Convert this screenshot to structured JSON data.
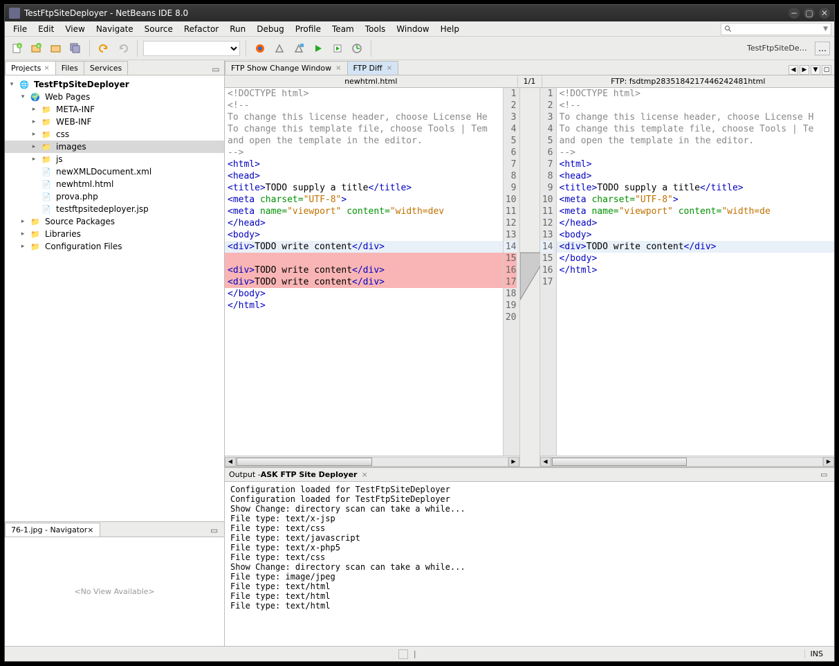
{
  "window_title": "TestFtpSiteDeployer - NetBeans IDE 8.0",
  "menubar": [
    "File",
    "Edit",
    "View",
    "Navigate",
    "Source",
    "Refactor",
    "Run",
    "Debug",
    "Profile",
    "Team",
    "Tools",
    "Window",
    "Help"
  ],
  "toolbar_project_label": "TestFtpSiteDepl...",
  "left_tabs": {
    "projects": "Projects",
    "files": "Files",
    "services": "Services"
  },
  "tree": {
    "root": "TestFtpSiteDeployer",
    "folders": [
      {
        "label": "Web Pages",
        "depth": 1,
        "icon": "web",
        "expanded": true
      },
      {
        "label": "META-INF",
        "depth": 2,
        "icon": "folder"
      },
      {
        "label": "WEB-INF",
        "depth": 2,
        "icon": "folder"
      },
      {
        "label": "css",
        "depth": 2,
        "icon": "folder"
      },
      {
        "label": "images",
        "depth": 2,
        "icon": "folder",
        "selected": true
      },
      {
        "label": "js",
        "depth": 2,
        "icon": "folder"
      },
      {
        "label": "newXMLDocument.xml",
        "depth": 2,
        "icon": "file",
        "leaf": true
      },
      {
        "label": "newhtml.html",
        "depth": 2,
        "icon": "file",
        "leaf": true
      },
      {
        "label": "prova.php",
        "depth": 2,
        "icon": "file",
        "leaf": true
      },
      {
        "label": "testftpsitedeployer.jsp",
        "depth": 2,
        "icon": "file",
        "leaf": true
      },
      {
        "label": "Source Packages",
        "depth": 1,
        "icon": "folder"
      },
      {
        "label": "Libraries",
        "depth": 1,
        "icon": "folder"
      },
      {
        "label": "Configuration Files",
        "depth": 1,
        "icon": "folder"
      }
    ]
  },
  "navigator": {
    "title": "76-1.jpg - Navigator",
    "empty": "<No View Available>"
  },
  "editor_tabs": [
    {
      "label": "FTP Show Change Window",
      "active": false
    },
    {
      "label": "FTP Diff",
      "active": true
    }
  ],
  "diff": {
    "left_title": "newhtml.html",
    "counter": "1/1",
    "right_title": "FTP: fsdtmp28351842174462424​81html"
  },
  "code_left": [
    {
      "n": 1,
      "t": "<!DOCTYPE html>",
      "cls": "c-doctype"
    },
    {
      "n": 2,
      "t": "<!--",
      "cls": "c-comment"
    },
    {
      "n": 3,
      "t": "To change this license header, choose License He",
      "cls": "c-comment"
    },
    {
      "n": 4,
      "t": "To change this template file, choose Tools | Tem",
      "cls": "c-comment"
    },
    {
      "n": 5,
      "t": "and open the template in the editor.",
      "cls": "c-comment"
    },
    {
      "n": 6,
      "t": "-->",
      "cls": "c-comment"
    },
    {
      "n": 7,
      "t": "<html>",
      "cls": "c-tag"
    },
    {
      "n": 8,
      "t": "    <head>",
      "cls": "c-tag"
    },
    {
      "n": 9,
      "html": "        <span class='c-tag'>&lt;title&gt;</span>TODO supply a title<span class='c-tag'>&lt;/title&gt;</span>"
    },
    {
      "n": 10,
      "html": "        <span class='c-tag'>&lt;meta</span> <span class='c-attr'>charset=</span><span class='c-str'>\"UTF-8\"</span><span class='c-tag'>&gt;</span>"
    },
    {
      "n": 11,
      "html": "        <span class='c-tag'>&lt;meta</span> <span class='c-attr'>name=</span><span class='c-str'>\"viewport\"</span> <span class='c-attr'>content=</span><span class='c-str'>\"width=dev</span>"
    },
    {
      "n": 12,
      "t": "    </head>",
      "cls": "c-tag"
    },
    {
      "n": 13,
      "t": "    <body>",
      "cls": "c-tag"
    },
    {
      "n": 14,
      "html": "        <span class='c-tag'>&lt;div&gt;</span>TODO write content<span class='c-tag'>&lt;/div&gt;</span>",
      "hl": "hlcur"
    },
    {
      "n": 15,
      "t": "",
      "hl": "hlred"
    },
    {
      "n": 16,
      "html": "        <span class='c-tag'>&lt;div&gt;</span>TODO write content<span class='c-tag'>&lt;/div&gt;</span>",
      "hl": "hlred"
    },
    {
      "n": 17,
      "html": "        <span class='c-tag'>&lt;div&gt;</span>TODO write content<span class='c-tag'>&lt;/div&gt;</span>",
      "hl": "hlred"
    },
    {
      "n": 18,
      "t": "    </body>",
      "cls": "c-tag"
    },
    {
      "n": 19,
      "t": "</html>",
      "cls": "c-tag"
    },
    {
      "n": 20,
      "t": ""
    }
  ],
  "code_right": [
    {
      "n": 1,
      "t": "<!DOCTYPE html>",
      "cls": "c-doctype"
    },
    {
      "n": 2,
      "t": "<!--",
      "cls": "c-comment"
    },
    {
      "n": 3,
      "t": "To change this license header, choose License H",
      "cls": "c-comment"
    },
    {
      "n": 4,
      "t": "To change this template file, choose Tools | Te",
      "cls": "c-comment"
    },
    {
      "n": 5,
      "t": "and open the template in the editor.",
      "cls": "c-comment"
    },
    {
      "n": 6,
      "t": "-->",
      "cls": "c-comment"
    },
    {
      "n": 7,
      "t": "<html>",
      "cls": "c-tag"
    },
    {
      "n": 8,
      "t": "    <head>",
      "cls": "c-tag"
    },
    {
      "n": 9,
      "html": "        <span class='c-tag'>&lt;title&gt;</span>TODO supply a title<span class='c-tag'>&lt;/title&gt;</span>"
    },
    {
      "n": 10,
      "html": "        <span class='c-tag'>&lt;meta</span> <span class='c-attr'>charset=</span><span class='c-str'>\"UTF-8\"</span><span class='c-tag'>&gt;</span>"
    },
    {
      "n": 11,
      "html": "        <span class='c-tag'>&lt;meta</span> <span class='c-attr'>name=</span><span class='c-str'>\"viewport\"</span> <span class='c-attr'>content=</span><span class='c-str'>\"width=de</span>"
    },
    {
      "n": 12,
      "t": "    </head>",
      "cls": "c-tag"
    },
    {
      "n": 13,
      "t": "    <body>",
      "cls": "c-tag"
    },
    {
      "n": 14,
      "html": "        <span class='c-tag'>&lt;div&gt;</span>TODO write content<span class='c-tag'>&lt;/div&gt;</span>",
      "hl": "hlcur"
    },
    {
      "n": 15,
      "t": "    </body>",
      "cls": "c-tag"
    },
    {
      "n": 16,
      "t": "</html>",
      "cls": "c-tag"
    },
    {
      "n": 17,
      "t": ""
    }
  ],
  "output": {
    "title_prefix": "Output - ",
    "title_bold": "ASK FTP Site Deployer",
    "lines": [
      "Configuration loaded for TestFtpSiteDeployer",
      "Configuration loaded for TestFtpSiteDeployer",
      "Show Change: directory scan can take a while...",
      "File type: text/x-jsp",
      "File type: text/css",
      "File type: text/javascript",
      "File type: text/x-php5",
      "File type: text/css",
      "Show Change: directory scan can take a while...",
      "File type: image/jpeg",
      "File type: text/html",
      "File type: text/html",
      "File type: text/html"
    ]
  },
  "status_ins": "INS"
}
